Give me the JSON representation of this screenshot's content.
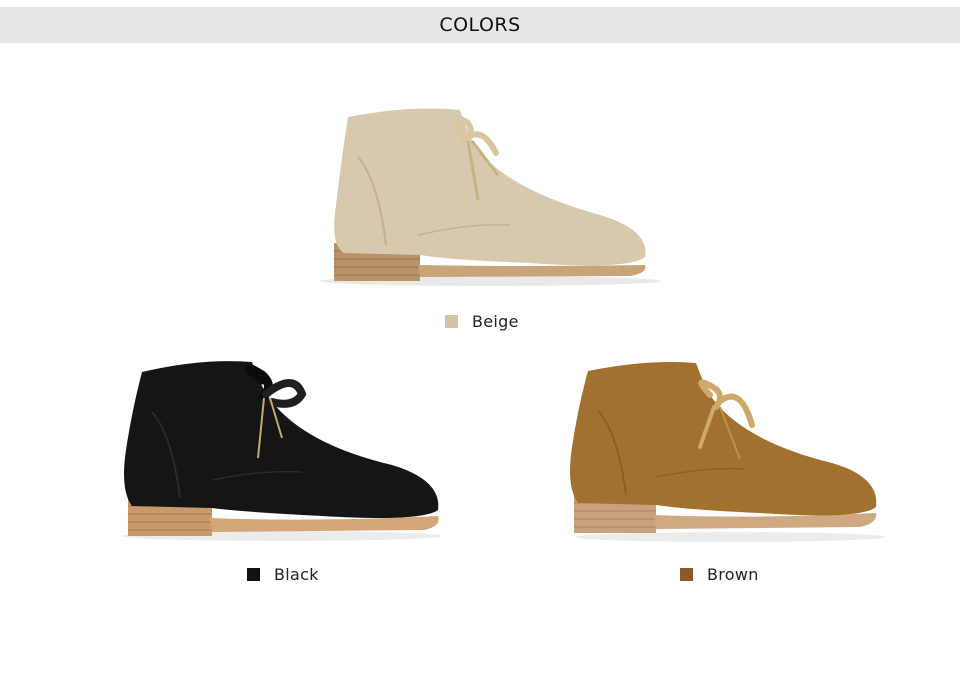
{
  "header": {
    "title": "COLORS"
  },
  "variants": [
    {
      "label": "Beige",
      "swatch_color": "#d5c3a6",
      "boot_color": "#d8c9ae",
      "lace_color": "#d9c7a3",
      "icon": "beige-boot-image"
    },
    {
      "label": "Black",
      "swatch_color": "#111111",
      "boot_color": "#151515",
      "lace_color": "#1a1a1a",
      "icon": "black-boot-image"
    },
    {
      "label": "Brown",
      "swatch_color": "#8a5a2b",
      "boot_color": "#a2712f",
      "lace_color": "#cfa86a",
      "icon": "brown-boot-image"
    }
  ]
}
